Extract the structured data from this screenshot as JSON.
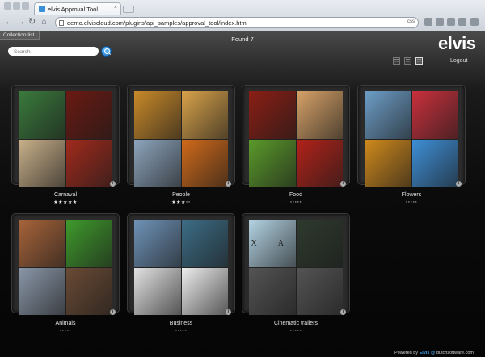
{
  "browser": {
    "tab_title": "elvis Approval Tool",
    "tab_close": "×",
    "url": "demo.elviscloud.com/plugins/api_samples/approval_tool/index.html",
    "url_suffix": "css",
    "nav": {
      "back": "←",
      "forward": "→",
      "reload": "↻",
      "home": "⌂"
    }
  },
  "header": {
    "collection_tab": "Collection list",
    "found": "Found 7",
    "search_placeholder": "Search",
    "logo_text": "elvis",
    "logout": "Logout"
  },
  "collections": [
    {
      "title": "Carnaval",
      "rating": 5,
      "tiles": [
        "#3a7a3c",
        "#6a1a12",
        "#c9b18a",
        "#a02a1c"
      ]
    },
    {
      "title": "People",
      "rating": 3,
      "tiles": [
        "#c98a2a",
        "#d8a24a",
        "#8da5bd",
        "#d06a1a"
      ]
    },
    {
      "title": "Food",
      "rating": 0,
      "tiles": [
        "#8a1e14",
        "#d6a268",
        "#5a9a2a",
        "#b2221a"
      ]
    },
    {
      "title": "Flowers",
      "rating": 0,
      "tiles": [
        "#6d9ec8",
        "#c9303c",
        "#d08a1c",
        "#3e8fd6"
      ]
    },
    {
      "title": "Animals",
      "rating": 0,
      "tiles": [
        "#a8643a",
        "#3f9a2c",
        "#8a97a8",
        "#6a4a34"
      ]
    },
    {
      "title": "Business",
      "rating": 0,
      "tiles": [
        "#6f93b8",
        "#3c6d86",
        "#e2e2e2",
        "#ededed"
      ]
    },
    {
      "title": "Cinematic trailers",
      "rating": 0,
      "tiles": [
        "#b3d3e3",
        "#2e3a2e",
        "#545454",
        "#545454"
      ],
      "tile_text": [
        "X A",
        "",
        "",
        ""
      ]
    }
  ],
  "footer": {
    "prefix": "Powered by",
    "brand": "Elvis",
    "sep": "@",
    "site": "dutchsoftware.com"
  }
}
